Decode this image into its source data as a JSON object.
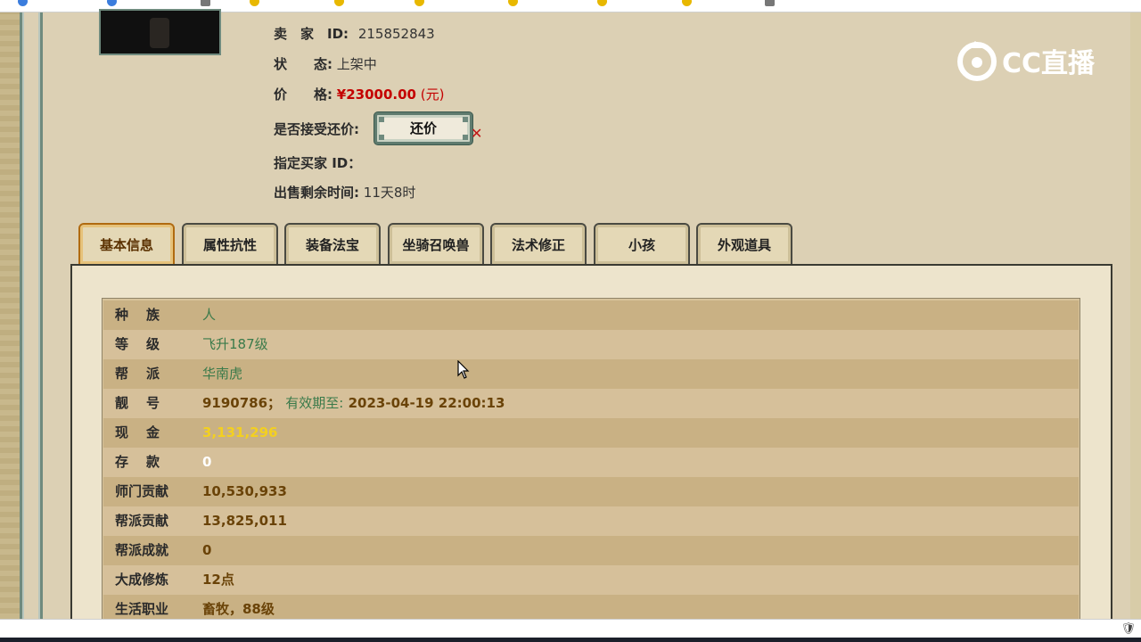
{
  "seller": {
    "label": "卖　家　ID:",
    "value": "215852843"
  },
  "status": {
    "label": "状　　态:",
    "value": "上架中"
  },
  "price": {
    "label": "价　　格:",
    "amount": "¥23000.00",
    "unit": "(元)"
  },
  "accept_counter": {
    "label": "是否接受还价:",
    "button": "还价",
    "close": "✕"
  },
  "buyer_id": {
    "label": "指定买家 ID："
  },
  "remaining": {
    "label": "出售剩余时间:",
    "value": "11天8时"
  },
  "watermark": {
    "text": "CC直播"
  },
  "tabs": [
    {
      "label": "基本信息",
      "active": true
    },
    {
      "label": "属性抗性"
    },
    {
      "label": "装备法宝"
    },
    {
      "label": "坐骑召唤兽"
    },
    {
      "label": "法术修正"
    },
    {
      "label": "小孩"
    },
    {
      "label": "外观道具"
    }
  ],
  "rows": [
    {
      "key": "种族",
      "value": "人"
    },
    {
      "key": "等级",
      "value": "飞升187级"
    },
    {
      "key": "帮派",
      "value": "华南虎"
    },
    {
      "key": "靓号",
      "value": "9190786；",
      "note": "有效期至:",
      "extra": "2023-04-19 22:00:13"
    },
    {
      "key": "现金",
      "value": "3,131,296"
    },
    {
      "key": "存款",
      "value": "0"
    },
    {
      "key": "师门贡献",
      "value": "10,530,933"
    },
    {
      "key": "帮派贡献",
      "value": "13,825,011"
    },
    {
      "key": "帮派成就",
      "value": "0"
    },
    {
      "key": "大成修炼",
      "value": "12点"
    },
    {
      "key": "生活职业",
      "value": "畜牧，88级"
    }
  ],
  "colors": {
    "accent_green": "#3a7a4a",
    "price_red": "#c40000",
    "gold": "#f3d020"
  }
}
